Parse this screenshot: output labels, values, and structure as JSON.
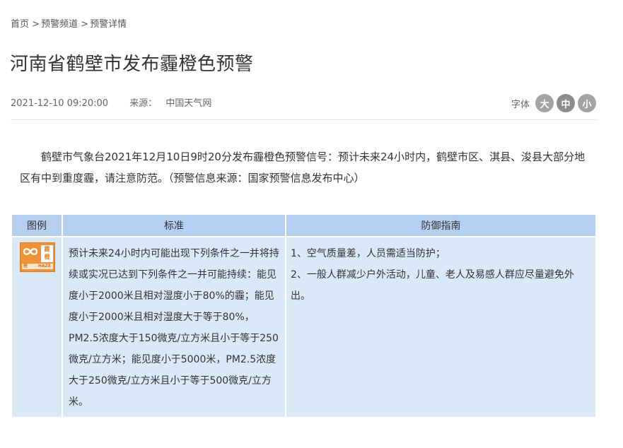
{
  "breadcrumb": {
    "home": "首页",
    "sep1": ">",
    "channel": "预警频道",
    "sep2": ">",
    "detail": "预警详情"
  },
  "article": {
    "title": "河南省鹤壁市发布霾橙色预警",
    "datetime": "2021-12-10 09:20:00",
    "source_label": "来源：",
    "source": "中国天气网",
    "body": "鹤壁市气象台2021年12月10日9时20分发布霾橙色预警信号：预计未来24小时内，鹤壁市区、淇县、浚县大部分地区有中到重度霾，请注意防范。（预警信息来源：国家预警信息发布中心）"
  },
  "font_size": {
    "label": "字体",
    "large": "大",
    "medium": "中",
    "small": "小"
  },
  "table": {
    "headers": [
      "图例",
      "标准",
      "防御指南"
    ],
    "icon": {
      "name": "haze-orange-warning-icon",
      "cn_text": "霾\n橙",
      "band_left": "橙",
      "band_right": "HAZE",
      "color": "#f19135"
    },
    "standard": "预计未来24小时内可能出现下列条件之一并将持续或实况已达到下列条件之一并可能持续：能见度小于2000米且相对湿度小于80%的霾；能见度小于2000米且相对湿度大于等于80%，PM2.5浓度大于150微克/立方米且小于等于250微克/立方米；能见度小于5000米，PM2.5浓度大于250微克/立方米且小于等于500微克/立方米。",
    "guide": [
      "1、空气质量差，人员需适当防护；",
      "2、一般人群减少户外活动，儿童、老人及易感人群应尽量避免外出。"
    ]
  },
  "colors": {
    "header_bg": "#b5cff0",
    "cell_bg": "#dbe8f8",
    "font_btn": "#a3a3a3"
  }
}
